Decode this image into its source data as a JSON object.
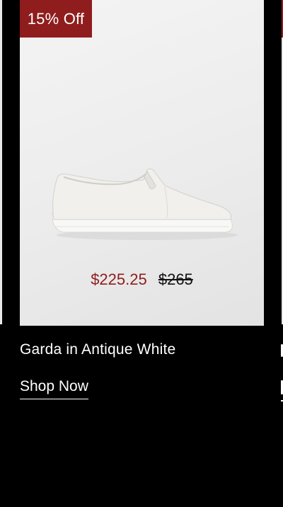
{
  "product": {
    "badge": "15% Off",
    "name": "Garda in Antique White",
    "sale_price": "$225.25",
    "original_price": "$265",
    "cta_label": "Shop Now"
  },
  "colors": {
    "background": "#000000",
    "badge": "#8f1d1d",
    "sale_price": "#8f1d1d",
    "card": "#eeeeee"
  },
  "icons": {
    "product_image": "white-slip-on-sneaker"
  }
}
